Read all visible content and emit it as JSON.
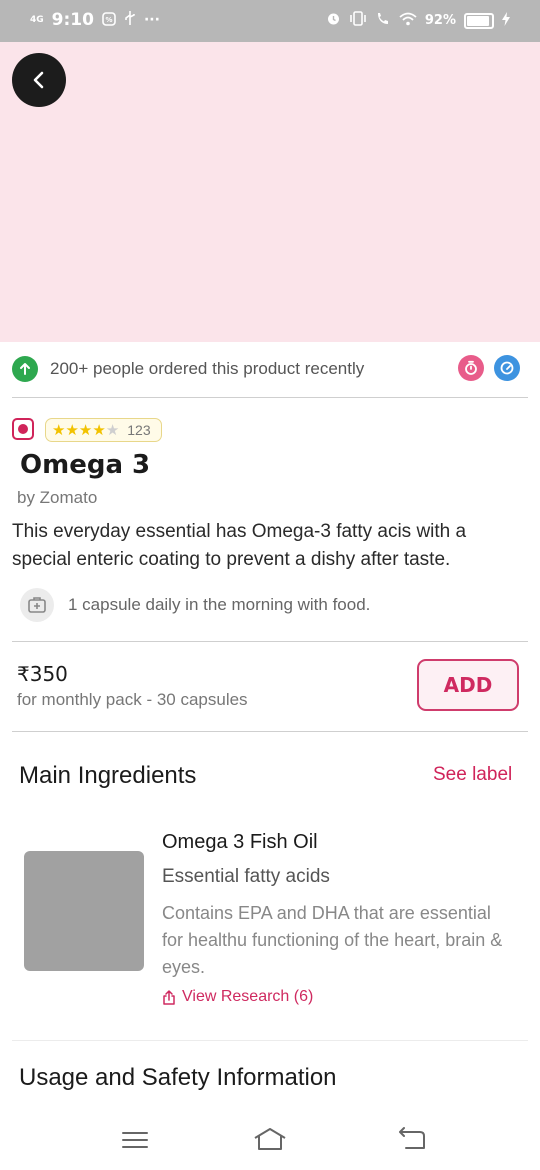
{
  "status_bar": {
    "network": "4G",
    "time": "9:10",
    "battery": "92%",
    "battery_level": 0.92
  },
  "back_button": {
    "icon": "chevron-left-icon"
  },
  "popularity": {
    "text": "200+ people ordered this product recently",
    "icon": "arrow-up-icon",
    "accent": "#2ea84f"
  },
  "product": {
    "rating_stars": 4,
    "rating_max": 5,
    "rating_count": "123",
    "name": "Omega 3",
    "brand": "by Zomato",
    "description": "This everyday essential has Omega-3 fatty acis with a special enteric coating to prevent a dishy after taste.",
    "dosage": "1 capsule daily in the morning with food.",
    "price": "₹350",
    "pack_info": "for monthly pack - 30 capsules",
    "add_label": "ADD"
  },
  "ingredients": {
    "section_title": "Main Ingredients",
    "see_label": "See label",
    "items": [
      {
        "name": "Omega 3 Fish Oil",
        "subtitle": "Essential fatty acids",
        "description": "Contains EPA and DHA that are essential for healthu functioning of the heart, brain & eyes.",
        "research_link": "View Research (6)"
      }
    ]
  },
  "usage_section": {
    "title": "Usage and Safety Information"
  },
  "colors": {
    "brand": "#cf2a60",
    "hero_bg": "#fbe4ea",
    "timer": "#e85c8a",
    "speed": "#3d93e0"
  }
}
